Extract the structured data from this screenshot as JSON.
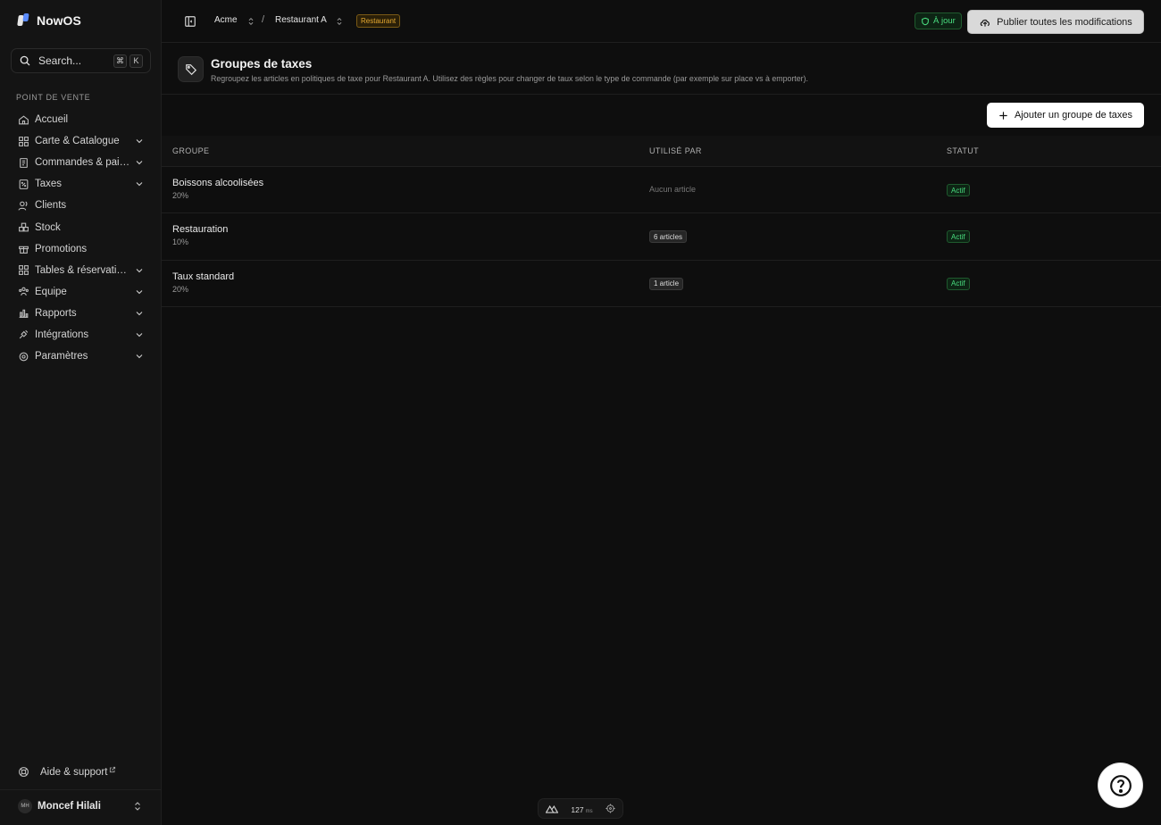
{
  "app": {
    "name": "NowOS"
  },
  "search": {
    "placeholder": "Search...",
    "kbd_1": "⌘",
    "kbd_2": "K"
  },
  "sidebar": {
    "section": "POINT DE VENTE",
    "items": [
      {
        "label": "Accueil",
        "icon": "home-icon",
        "chevron": false
      },
      {
        "label": "Carte & Catalogue",
        "icon": "grid-icon",
        "chevron": true
      },
      {
        "label": "Commandes & paiements",
        "icon": "receipt-icon",
        "chevron": true
      },
      {
        "label": "Taxes",
        "icon": "tax-icon",
        "chevron": true
      },
      {
        "label": "Clients",
        "icon": "users-icon",
        "chevron": false
      },
      {
        "label": "Stock",
        "icon": "boxes-icon",
        "chevron": false
      },
      {
        "label": "Promotions",
        "icon": "gift-icon",
        "chevron": false
      },
      {
        "label": "Tables & réservations",
        "icon": "layout-icon",
        "chevron": true
      },
      {
        "label": "Équipe",
        "icon": "team-icon",
        "chevron": true
      },
      {
        "label": "Rapports",
        "icon": "chart-icon",
        "chevron": true
      },
      {
        "label": "Intégrations",
        "icon": "plug-icon",
        "chevron": true
      },
      {
        "label": "Paramètres",
        "icon": "gear-icon",
        "chevron": true
      }
    ],
    "help_label": "Aide & support",
    "user": {
      "initials": "MH",
      "name": "Moncef Hilali"
    }
  },
  "topbar": {
    "org": "Acme",
    "separator": "/",
    "location": "Restaurant A",
    "location_badge": "Restaurant",
    "status": "À jour",
    "publish_label": "Publier toutes les modifications"
  },
  "page": {
    "title": "Groupes de taxes",
    "subtitle": "Regroupez les articles en politiques de taxe pour Restaurant A. Utilisez des règles pour changer de taux selon le type de commande (par exemple sur place vs à emporter).",
    "add_label": "Ajouter un groupe de taxes"
  },
  "table": {
    "columns": [
      "GROUPE",
      "UTILISÉ PAR",
      "STATUT"
    ],
    "rows": [
      {
        "name": "Boissons alcoolisées",
        "rate": "20%",
        "used": "Aucun article",
        "used_chip": false,
        "status": "Actif"
      },
      {
        "name": "Restauration",
        "rate": "10%",
        "used": "6 articles",
        "used_chip": true,
        "status": "Actif"
      },
      {
        "name": "Taux standard",
        "rate": "20%",
        "used": "1 article",
        "used_chip": true,
        "status": "Actif"
      }
    ]
  },
  "perf": {
    "value": "127",
    "unit": "ms"
  },
  "colors": {
    "accent": "#5b8cff",
    "success": "#4ade80",
    "warning": "#e5a931"
  }
}
